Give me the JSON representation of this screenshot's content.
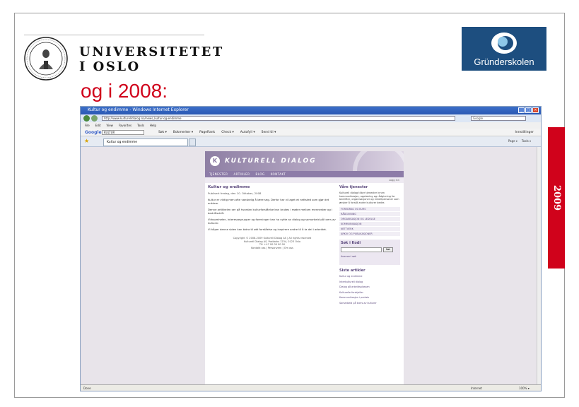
{
  "slide": {
    "heading": "og i 2008:",
    "year": "2009",
    "uio": {
      "line1": "UNIVERSITETET",
      "line2": "I OSLO"
    },
    "grunderskolen": {
      "name": "Gründerskolen"
    }
  },
  "browser": {
    "title": "Kultur og endimme - Windows Internet Explorer",
    "url": "http://www.kulturelldialog.no/news_kultur-og-endimme",
    "search_placeholder": "Google",
    "menu": [
      "File",
      "Edit",
      "View",
      "Favorites",
      "Tools",
      "Help"
    ],
    "google_bar": {
      "logo": "Google",
      "field": "KULTUR",
      "tools": [
        "Søk ▾",
        "Bokmerker ▾",
        "PageRank",
        "Check ▾",
        "Autofyll ▾",
        "Send til ▾"
      ],
      "settings": "Innstillinger"
    },
    "tab_label": "Kultur og endimme",
    "tab_tools": [
      "Page ▾",
      "Tools ▾"
    ],
    "status": {
      "text": "Done",
      "zone": "Internet",
      "zoom": "100% ▾"
    }
  },
  "webpage": {
    "logo_text": "KULTURELL DIALOG",
    "nav": [
      "TJENESTER",
      "ARTIKLER",
      "BLOG",
      "KONTAKT"
    ],
    "subnav": "Logg inn",
    "article": {
      "title": "Kultur og endimme",
      "date": "Publisert fredag, den 10. Oktober, 2008",
      "paragraphs": [
        "Kultur er viktig men ofte vanskelig å lære seg. Derfor har vi laget et nettsted som gjør det enklere.",
        "Denne artikkelen ser på hvordan kulturforståelse kan brukes i møter mellom mennesker og i bedriftsdrift.",
        "Virksomheter, interessegrupper og foreninger kan ha nytte av dialog og samarbeid på tvers av kulturer.",
        "Vi håper denne siden kan bidra til økt forståelse og inspirere andre til å ta del i arbeidet."
      ],
      "footer": [
        "Copyright © 2008-2009 Kulturell Dialog AS | All rights reserved",
        "Kulturell Dialog AS, Postboks 1234, 0123 Oslo",
        "Tlf: +47 00 00 00 00",
        "Kontakt oss | Personvern | Om oss"
      ]
    },
    "sidebar": {
      "title": "Våre tjenester",
      "intro": "Kulturell dialog tilbyr tjenester innen kommunikasjon, opplæring og rådgivning for bedrifter, organisasjoner og enkeltpersoner som ønsker å forstå andre kulturer bedre.",
      "links": [
        "FOREDRAG OG KURS",
        "RÅDGIVNING",
        "ORGANISASJON OG LEDELSE",
        "KOMMUNIKASJON",
        "NETTVERK",
        "ARKIV OG PUBLIKASJONER"
      ],
      "search_title": "Søk i Kodi",
      "search_button": "Søk",
      "search_adv": "Avansert søk",
      "latest_title": "Siste artikler",
      "latest": [
        "Kultur og endimme",
        "Interkulturell dialog",
        "Dialog på arbeidsplassen",
        "Kulturelle forskjeller",
        "Kommunikasjon i praksis",
        "Samarbeid på tvers av kulturer"
      ]
    }
  }
}
